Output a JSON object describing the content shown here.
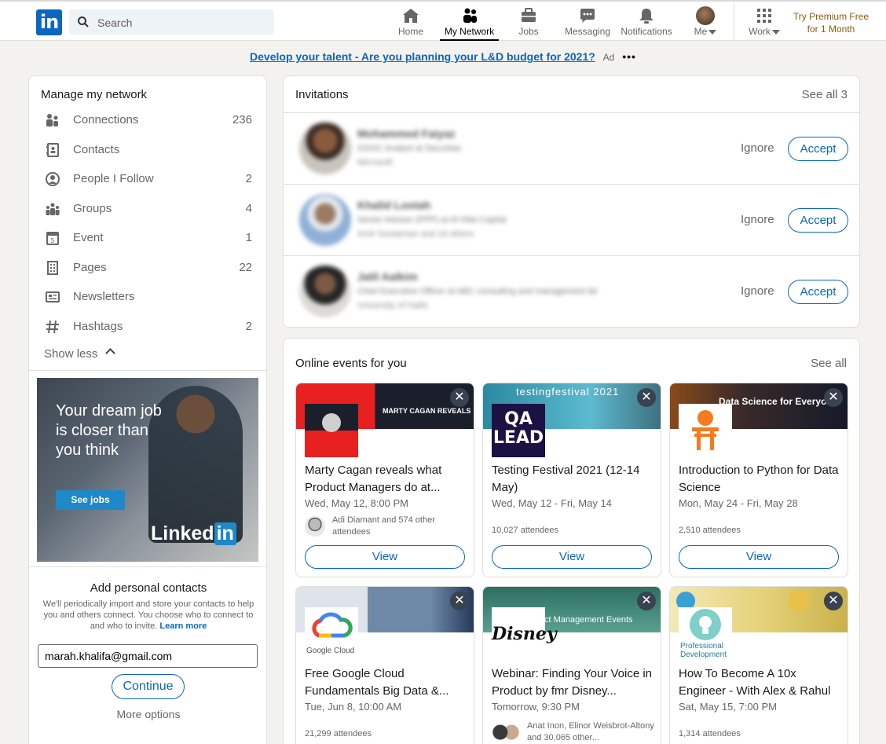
{
  "nav": {
    "search_placeholder": "Search",
    "items": [
      {
        "label": "Home"
      },
      {
        "label": "My Network"
      },
      {
        "label": "Jobs"
      },
      {
        "label": "Messaging"
      },
      {
        "label": "Notifications"
      },
      {
        "label": "Me"
      },
      {
        "label": "Work"
      }
    ],
    "premium_line1": "Try Premium Free",
    "premium_line2": "for 1 Month",
    "logo_text": "in"
  },
  "ad": {
    "link": "Develop your talent - Are you planning your L&D budget for 2021?",
    "mark": "Ad",
    "more": "•••"
  },
  "sidebar": {
    "title": "Manage my network",
    "items": [
      {
        "label": "Connections",
        "count": "236",
        "icon": "people-icon"
      },
      {
        "label": "Contacts",
        "count": "",
        "icon": "contact-book-icon"
      },
      {
        "label": "People I Follow",
        "count": "2",
        "icon": "follow-icon"
      },
      {
        "label": "Groups",
        "count": "4",
        "icon": "groups-icon"
      },
      {
        "label": "Event",
        "count": "1",
        "icon": "calendar-icon"
      },
      {
        "label": "Pages",
        "count": "22",
        "icon": "building-icon"
      },
      {
        "label": "Newsletters",
        "count": "",
        "icon": "newsletter-icon"
      },
      {
        "label": "Hashtags",
        "count": "2",
        "icon": "hashtag-icon"
      }
    ],
    "show_less": "Show less",
    "promo": {
      "text": "Your dream job is closer than you think",
      "button": "See jobs",
      "brand": "Linked",
      "brand_in": "in"
    },
    "add_contacts": {
      "title": "Add personal contacts",
      "desc": "We'll periodically import and store your contacts to help you and others connect. You choose who to connect to and who to invite.",
      "learn_more": "Learn more",
      "email": "marah.khalifa@gmail.com",
      "continue": "Continue",
      "more_options": "More options"
    }
  },
  "invitations": {
    "title": "Invitations",
    "see_all": "See all 3",
    "ignore": "Ignore",
    "accept": "Accept",
    "rows": [
      {
        "name": "Mohammed Faiyaz",
        "headline": "GSOC Analyst at Securitas",
        "mutual": "Microsoft"
      },
      {
        "name": "Khalid Lootah",
        "headline": "Senior Adviser (PPP) at Al Hilal Capital",
        "mutual": "Amir Soulaiman and 16 others"
      },
      {
        "name": "Jalil Aalkim",
        "headline": "Chief Executive Officer at ABC consulting and management ltd",
        "mutual": "University of Haifa"
      }
    ]
  },
  "events": {
    "title": "Online events for you",
    "see_all": "See all",
    "view": "View",
    "close": "✕",
    "items": [
      {
        "title": "Marty Cagan reveals what Product Managers do at...",
        "date": "Wed, May 12, 8:00 PM",
        "attendees": "Adi Diamant and 574 other attendees",
        "banner_text": "MARTY CAGAN REVEALS",
        "logo": "",
        "show_av": true
      },
      {
        "title": "Testing Festival 2021 (12-14 May)",
        "date": "Wed, May 12 - Fri, May 14",
        "attendees": "10,027 attendees",
        "banner_text": "testingfestival 2021",
        "logo": "QA LEAD",
        "show_av": false
      },
      {
        "title": "Introduction to Python for Data Science",
        "date": "Mon, May 24 - Fri, May 28",
        "attendees": "2,510 attendees",
        "banner_text": "Data Science for Everyone",
        "logo": "",
        "show_av": false
      },
      {
        "title": "Free Google Cloud Fundamentals Big Data &...",
        "date": "Tue, Jun 8, 10:00 AM",
        "attendees": "21,299 attendees",
        "banner_text": "",
        "logo": "Google Cloud",
        "show_av": false
      },
      {
        "title": "Webinar: Finding Your Voice in Product by fmr Disney...",
        "date": "Tomorrow, 9:30 PM",
        "attendees": "Anat Inon, Elinor Weisbrot-Altony and 30,065 other...",
        "banner_text": "ct Management Events",
        "logo": "Disney",
        "show_av": true
      },
      {
        "title": "How To Become A 10x Engineer - With Alex & Rahul",
        "date": "Sat, May 15, 7:00 PM",
        "attendees": "1,314 attendees",
        "banner_text": "",
        "logo": "Professional Development",
        "show_av": false
      }
    ]
  }
}
